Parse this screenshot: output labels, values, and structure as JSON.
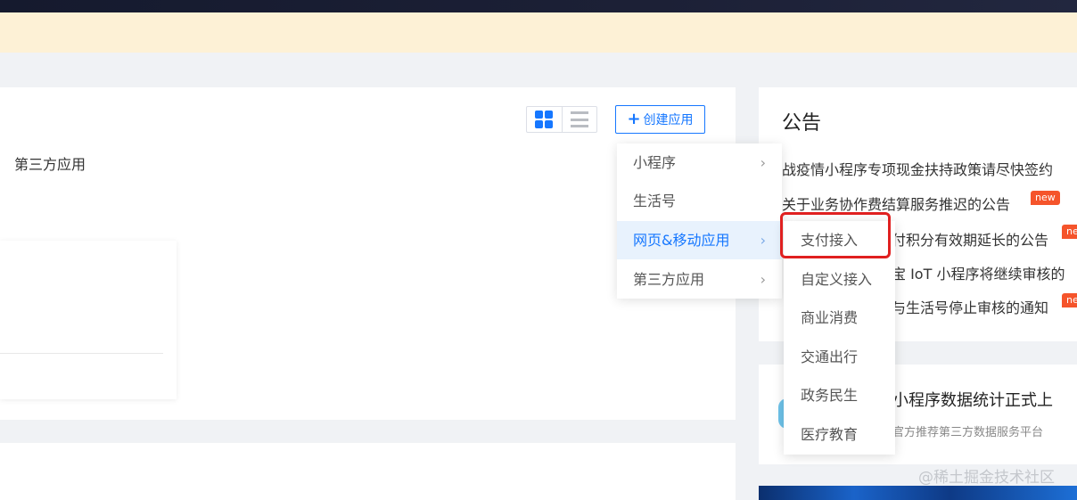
{
  "toolbar": {
    "create_label": "创建应用",
    "create_icon": "plus-icon",
    "grid_view_icon": "grid-view-icon",
    "list_view_icon": "list-view-icon"
  },
  "tabs": {
    "third_party": "第三方应用"
  },
  "announcements": {
    "title": "公告",
    "items": [
      {
        "text": "战疫情小程序专项现金扶持政策请尽快签约",
        "badge": ""
      },
      {
        "text": "关于业务协作费结算服务推迟的公告",
        "badge": "new"
      },
      {
        "text": "付积分有效期延长的公告",
        "badge": "ne"
      },
      {
        "text": "宝 IoT 小程序将继续审核的",
        "badge": ""
      },
      {
        "text": "与生活号停止审核的通知",
        "badge": "ne"
      }
    ]
  },
  "promo": {
    "title": "小程序数据统计正式上",
    "subtitle": "官方推荐第三方数据服务平台"
  },
  "menu": {
    "items": [
      {
        "label": "小程序",
        "has_submenu": true
      },
      {
        "label": "生活号",
        "has_submenu": false
      },
      {
        "label": "网页&移动应用",
        "has_submenu": true
      },
      {
        "label": "第三方应用",
        "has_submenu": true
      }
    ],
    "active_index": 2
  },
  "submenu": {
    "items": [
      {
        "label": "支付接入"
      },
      {
        "label": "自定义接入"
      },
      {
        "label": "商业消费"
      },
      {
        "label": "交通出行"
      },
      {
        "label": "政务民生"
      },
      {
        "label": "医疗教育"
      }
    ]
  },
  "watermark": "@稀土掘金技术社区",
  "colors": {
    "accent": "#1677ff",
    "badge": "#f5542b",
    "highlight": "#e02020",
    "notice_bar": "#fdf1d6"
  }
}
